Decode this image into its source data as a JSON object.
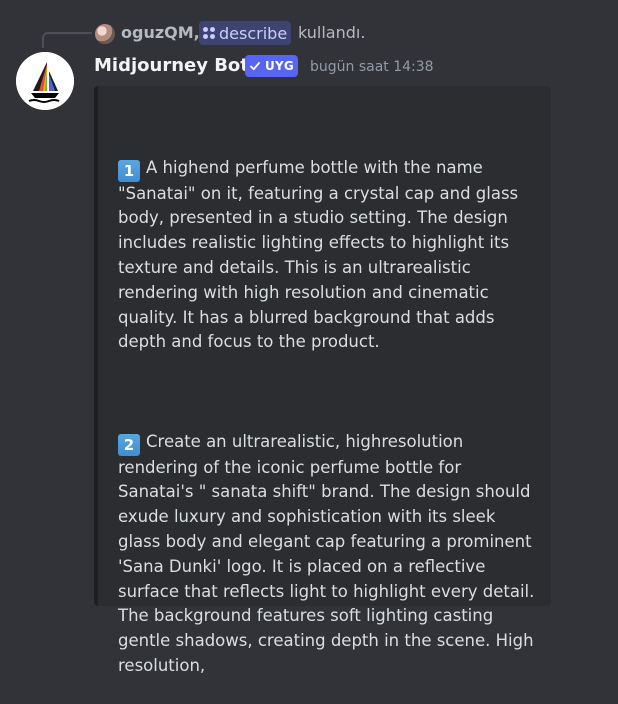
{
  "reply": {
    "username": "oguzQM,",
    "command": "describe",
    "suffix": "kullandı."
  },
  "message": {
    "author": "Midjourney Bot",
    "app_badge": "UYG",
    "timestamp": "bugün saat 14:38"
  },
  "embed": {
    "prompts": [
      {
        "number": "1",
        "text": "A highend perfume bottle with the name \"Sanatai\" on it, featuring a crystal cap and glass body, presented in a studio setting. The design includes realistic lighting effects to highlight its texture and details. This is an ultrarealistic rendering with high resolution and cinematic quality. It has a blurred background that adds depth and focus to the product."
      },
      {
        "number": "2",
        "text": "Create an ultrarealistic, highresolution rendering of the iconic perfume bottle for Sanatai's \" sanata shift\" brand. The design should exude luxury and sophistication with its sleek glass body and elegant cap featuring a prominent 'Sana Dunki' logo. It is placed on a reflective surface that reflects light to highlight every detail. The background features soft lighting casting gentle shadows, creating depth in the scene. High resolution,"
      }
    ]
  },
  "colors": {
    "background": "#313338",
    "embed_background": "#2b2d31",
    "badge": "#5865f2",
    "command_chip": "#3e4470",
    "command_text": "#c9cdfb",
    "keycap": "#3f8fd1"
  },
  "icons": {
    "command": "slash-command-icon",
    "badge": "checkmark-icon",
    "avatar": "midjourney-sailboat-logo"
  }
}
